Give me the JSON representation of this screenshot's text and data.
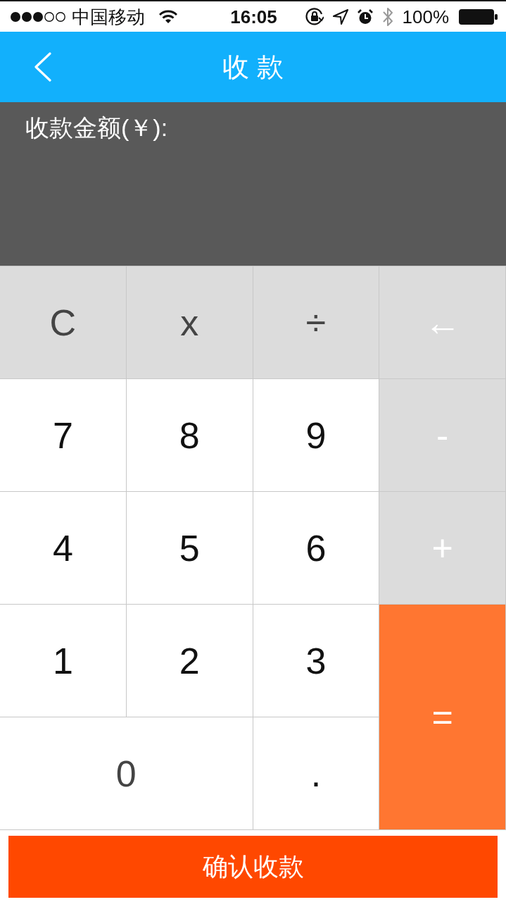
{
  "status_bar": {
    "carrier": "中国移动",
    "time": "16:05",
    "battery": "100%"
  },
  "nav_bar": {
    "title": "收 款"
  },
  "amount_panel": {
    "label": "收款金额(￥):"
  },
  "keypad": {
    "keys": [
      {
        "label": "C",
        "kind": "function"
      },
      {
        "label": "x",
        "kind": "function"
      },
      {
        "label": "÷",
        "kind": "function"
      },
      {
        "label": "←",
        "kind": "operator"
      },
      {
        "label": "7",
        "kind": "digit"
      },
      {
        "label": "8",
        "kind": "digit"
      },
      {
        "label": "9",
        "kind": "digit"
      },
      {
        "label": "-",
        "kind": "operator"
      },
      {
        "label": "4",
        "kind": "digit"
      },
      {
        "label": "5",
        "kind": "digit"
      },
      {
        "label": "6",
        "kind": "digit"
      },
      {
        "label": "+",
        "kind": "operator"
      },
      {
        "label": "1",
        "kind": "digit"
      },
      {
        "label": "2",
        "kind": "digit"
      },
      {
        "label": "3",
        "kind": "digit"
      },
      {
        "label": "=",
        "kind": "equals"
      },
      {
        "label": "0",
        "kind": "zero"
      },
      {
        "label": ".",
        "kind": "digit"
      }
    ]
  },
  "confirm_button": {
    "label": "确认收款"
  }
}
